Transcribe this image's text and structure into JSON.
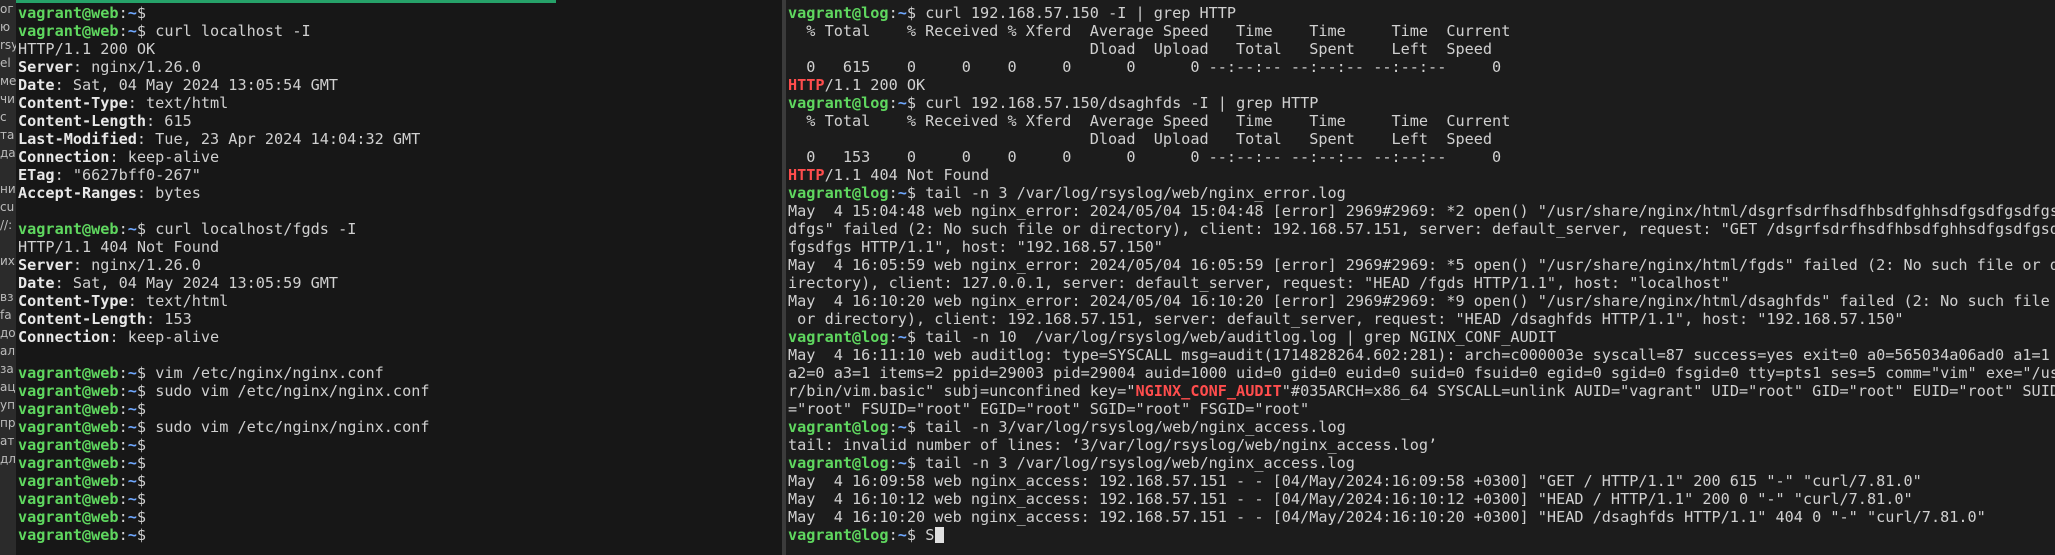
{
  "window": {
    "width": 2055,
    "height": 555
  },
  "colors": {
    "prompt_user": "#5fd75f",
    "prompt_path": "#6fa8ff",
    "highlight": "#ff4d4d",
    "text": "#d0d0d0"
  },
  "side_strip": [
    "ог",
    "ю",
    "rsy",
    "el",
    "ме",
    "чи",
    "с",
    "та",
    "да",
    "",
    "ни",
    "cu",
    "//:",
    "",
    "их",
    "",
    "вз",
    "fa",
    "до",
    "ал",
    "за",
    "ац",
    "уп",
    "пр",
    "ат",
    "дл"
  ],
  "left_terminal": {
    "lines": [
      {
        "segments": [
          {
            "t": "vagrant@web",
            "c": "pr-user"
          },
          {
            "t": ":",
            "c": ""
          },
          {
            "t": "~",
            "c": "pr-path"
          },
          {
            "t": "$",
            "c": ""
          }
        ]
      },
      {
        "segments": [
          {
            "t": "vagrant@web",
            "c": "pr-user"
          },
          {
            "t": ":",
            "c": ""
          },
          {
            "t": "~",
            "c": "pr-path"
          },
          {
            "t": "$ curl localhost -I",
            "c": ""
          }
        ]
      },
      {
        "segments": [
          {
            "t": "HTTP/1.1 200 OK",
            "c": ""
          }
        ]
      },
      {
        "segments": [
          {
            "t": "Server",
            "c": "bold"
          },
          {
            "t": ": nginx/1.26.0",
            "c": ""
          }
        ]
      },
      {
        "segments": [
          {
            "t": "Date",
            "c": "bold"
          },
          {
            "t": ": Sat, 04 May 2024 13:05:54 GMT",
            "c": ""
          }
        ]
      },
      {
        "segments": [
          {
            "t": "Content-Type",
            "c": "bold"
          },
          {
            "t": ": text/html",
            "c": ""
          }
        ]
      },
      {
        "segments": [
          {
            "t": "Content-Length",
            "c": "bold"
          },
          {
            "t": ": 615",
            "c": ""
          }
        ]
      },
      {
        "segments": [
          {
            "t": "Last-Modified",
            "c": "bold"
          },
          {
            "t": ": Tue, 23 Apr 2024 14:04:32 GMT",
            "c": ""
          }
        ]
      },
      {
        "segments": [
          {
            "t": "Connection",
            "c": "bold"
          },
          {
            "t": ": keep-alive",
            "c": ""
          }
        ]
      },
      {
        "segments": [
          {
            "t": "ETag",
            "c": "bold"
          },
          {
            "t": ": \"6627bff0-267\"",
            "c": ""
          }
        ]
      },
      {
        "segments": [
          {
            "t": "Accept-Ranges",
            "c": "bold"
          },
          {
            "t": ": bytes",
            "c": ""
          }
        ]
      },
      {
        "segments": []
      },
      {
        "segments": [
          {
            "t": "vagrant@web",
            "c": "pr-user"
          },
          {
            "t": ":",
            "c": ""
          },
          {
            "t": "~",
            "c": "pr-path"
          },
          {
            "t": "$ curl localhost/fgds -I",
            "c": ""
          }
        ]
      },
      {
        "segments": [
          {
            "t": "HTTP/1.1 404 Not Found",
            "c": ""
          }
        ]
      },
      {
        "segments": [
          {
            "t": "Server",
            "c": "bold"
          },
          {
            "t": ": nginx/1.26.0",
            "c": ""
          }
        ]
      },
      {
        "segments": [
          {
            "t": "Date",
            "c": "bold"
          },
          {
            "t": ": Sat, 04 May 2024 13:05:59 GMT",
            "c": ""
          }
        ]
      },
      {
        "segments": [
          {
            "t": "Content-Type",
            "c": "bold"
          },
          {
            "t": ": text/html",
            "c": ""
          }
        ]
      },
      {
        "segments": [
          {
            "t": "Content-Length",
            "c": "bold"
          },
          {
            "t": ": 153",
            "c": ""
          }
        ]
      },
      {
        "segments": [
          {
            "t": "Connection",
            "c": "bold"
          },
          {
            "t": ": keep-alive",
            "c": ""
          }
        ]
      },
      {
        "segments": []
      },
      {
        "segments": [
          {
            "t": "vagrant@web",
            "c": "pr-user"
          },
          {
            "t": ":",
            "c": ""
          },
          {
            "t": "~",
            "c": "pr-path"
          },
          {
            "t": "$ vim /etc/nginx/nginx.conf",
            "c": ""
          }
        ]
      },
      {
        "segments": [
          {
            "t": "vagrant@web",
            "c": "pr-user"
          },
          {
            "t": ":",
            "c": ""
          },
          {
            "t": "~",
            "c": "pr-path"
          },
          {
            "t": "$ sudo vim /etc/nginx/nginx.conf",
            "c": ""
          }
        ]
      },
      {
        "segments": [
          {
            "t": "vagrant@web",
            "c": "pr-user"
          },
          {
            "t": ":",
            "c": ""
          },
          {
            "t": "~",
            "c": "pr-path"
          },
          {
            "t": "$",
            "c": ""
          }
        ]
      },
      {
        "segments": [
          {
            "t": "vagrant@web",
            "c": "pr-user"
          },
          {
            "t": ":",
            "c": ""
          },
          {
            "t": "~",
            "c": "pr-path"
          },
          {
            "t": "$ sudo vim /etc/nginx/nginx.conf",
            "c": ""
          }
        ]
      },
      {
        "segments": [
          {
            "t": "vagrant@web",
            "c": "pr-user"
          },
          {
            "t": ":",
            "c": ""
          },
          {
            "t": "~",
            "c": "pr-path"
          },
          {
            "t": "$",
            "c": ""
          }
        ]
      },
      {
        "segments": [
          {
            "t": "vagrant@web",
            "c": "pr-user"
          },
          {
            "t": ":",
            "c": ""
          },
          {
            "t": "~",
            "c": "pr-path"
          },
          {
            "t": "$",
            "c": ""
          }
        ]
      },
      {
        "segments": [
          {
            "t": "vagrant@web",
            "c": "pr-user"
          },
          {
            "t": ":",
            "c": ""
          },
          {
            "t": "~",
            "c": "pr-path"
          },
          {
            "t": "$",
            "c": ""
          }
        ]
      },
      {
        "segments": [
          {
            "t": "vagrant@web",
            "c": "pr-user"
          },
          {
            "t": ":",
            "c": ""
          },
          {
            "t": "~",
            "c": "pr-path"
          },
          {
            "t": "$",
            "c": ""
          }
        ]
      },
      {
        "segments": [
          {
            "t": "vagrant@web",
            "c": "pr-user"
          },
          {
            "t": ":",
            "c": ""
          },
          {
            "t": "~",
            "c": "pr-path"
          },
          {
            "t": "$",
            "c": ""
          }
        ]
      },
      {
        "segments": [
          {
            "t": "vagrant@web",
            "c": "pr-user"
          },
          {
            "t": ":",
            "c": ""
          },
          {
            "t": "~",
            "c": "pr-path"
          },
          {
            "t": "$",
            "c": ""
          }
        ]
      }
    ]
  },
  "right_terminal": {
    "lines": [
      {
        "segments": [
          {
            "t": "vagrant@log",
            "c": "pr-user"
          },
          {
            "t": ":",
            "c": ""
          },
          {
            "t": "~",
            "c": "pr-path"
          },
          {
            "t": "$ curl 192.168.57.150 -I | grep HTTP",
            "c": ""
          }
        ]
      },
      {
        "segments": [
          {
            "t": "  % Total    % Received % Xferd  Average Speed   Time    Time     Time  Current",
            "c": ""
          }
        ]
      },
      {
        "segments": [
          {
            "t": "                                 Dload  Upload   Total   Spent    Left  Speed",
            "c": ""
          }
        ]
      },
      {
        "segments": [
          {
            "t": "  0   615    0     0    0     0      0      0 --:--:-- --:--:-- --:--:--     0",
            "c": ""
          }
        ]
      },
      {
        "segments": [
          {
            "t": "HTTP",
            "c": "hl"
          },
          {
            "t": "/1.1 200 OK",
            "c": ""
          }
        ]
      },
      {
        "segments": [
          {
            "t": "vagrant@log",
            "c": "pr-user"
          },
          {
            "t": ":",
            "c": ""
          },
          {
            "t": "~",
            "c": "pr-path"
          },
          {
            "t": "$ curl 192.168.57.150/dsaghfds -I | grep HTTP",
            "c": ""
          }
        ]
      },
      {
        "segments": [
          {
            "t": "  % Total    % Received % Xferd  Average Speed   Time    Time     Time  Current",
            "c": ""
          }
        ]
      },
      {
        "segments": [
          {
            "t": "                                 Dload  Upload   Total   Spent    Left  Speed",
            "c": ""
          }
        ]
      },
      {
        "segments": [
          {
            "t": "  0   153    0     0    0     0      0      0 --:--:-- --:--:-- --:--:--     0",
            "c": ""
          }
        ]
      },
      {
        "segments": [
          {
            "t": "HTTP",
            "c": "hl"
          },
          {
            "t": "/1.1 404 Not Found",
            "c": ""
          }
        ]
      },
      {
        "segments": [
          {
            "t": "vagrant@log",
            "c": "pr-user"
          },
          {
            "t": ":",
            "c": ""
          },
          {
            "t": "~",
            "c": "pr-path"
          },
          {
            "t": "$ tail -n 3 /var/log/rsyslog/web/nginx_error.log",
            "c": ""
          }
        ]
      },
      {
        "segments": [
          {
            "t": "May  4 15:04:48 web nginx_error: 2024/05/04 15:04:48 [error] 2969#2969: *2 open() \"/usr/share/nginx/html/dsgrfsdrfhsdfhbsdfghhsdfgsdfgsdfgs",
            "c": ""
          }
        ]
      },
      {
        "segments": [
          {
            "t": "dfgs\" failed (2: No such file or directory), client: 192.168.57.151, server: default_server, request: \"GET /dsgrfsdrfhsdfhbsdfghhsdfgsdfgsdf",
            "c": ""
          }
        ]
      },
      {
        "segments": [
          {
            "t": "fgsdfgs HTTP/1.1\", host: \"192.168.57.150\"",
            "c": ""
          }
        ]
      },
      {
        "segments": [
          {
            "t": "May  4 16:05:59 web nginx_error: 2024/05/04 16:05:59 [error] 2969#2969: *5 open() \"/usr/share/nginx/html/fgds\" failed (2: No such file or d",
            "c": ""
          }
        ]
      },
      {
        "segments": [
          {
            "t": "irectory), client: 127.0.0.1, server: default_server, request: \"HEAD /fgds HTTP/1.1\", host: \"localhost\"",
            "c": ""
          }
        ]
      },
      {
        "segments": [
          {
            "t": "May  4 16:10:20 web nginx_error: 2024/05/04 16:10:20 [error] 2969#2969: *9 open() \"/usr/share/nginx/html/dsaghfds\" failed (2: No such file",
            "c": ""
          }
        ]
      },
      {
        "segments": [
          {
            "t": " or directory), client: 192.168.57.151, server: default_server, request: \"HEAD /dsaghfds HTTP/1.1\", host: \"192.168.57.150\"",
            "c": ""
          }
        ]
      },
      {
        "segments": [
          {
            "t": "vagrant@log",
            "c": "pr-user"
          },
          {
            "t": ":",
            "c": ""
          },
          {
            "t": "~",
            "c": "pr-path"
          },
          {
            "t": "$ tail -n 10  /var/log/rsyslog/web/auditlog.log | grep NGINX_CONF_AUDIT",
            "c": ""
          }
        ]
      },
      {
        "segments": [
          {
            "t": "May  4 16:11:10 web auditlog: type=SYSCALL msg=audit(1714828264.602:281): arch=c000003e syscall=87 success=yes exit=0 a0=565034a06ad0 a1=1",
            "c": ""
          }
        ]
      },
      {
        "segments": [
          {
            "t": "a2=0 a3=1 items=2 ppid=29003 pid=29004 auid=1000 uid=0 gid=0 euid=0 suid=0 fsuid=0 egid=0 sgid=0 fsgid=0 tty=pts1 ses=5 comm=\"vim\" exe=\"/us",
            "c": ""
          }
        ]
      },
      {
        "segments": [
          {
            "t": "r/bin/vim.basic\" subj=unconfined key=\"",
            "c": ""
          },
          {
            "t": "NGINX_CONF_AUDIT",
            "c": "hl"
          },
          {
            "t": "\"#035ARCH=x86_64 SYSCALL=unlink AUID=\"vagrant\" UID=\"root\" GID=\"root\" EUID=\"root\" SUID",
            "c": ""
          }
        ]
      },
      {
        "segments": [
          {
            "t": "=\"root\" FSUID=\"root\" EGID=\"root\" SGID=\"root\" FSGID=\"root\"",
            "c": ""
          }
        ]
      },
      {
        "segments": [
          {
            "t": "vagrant@log",
            "c": "pr-user"
          },
          {
            "t": ":",
            "c": ""
          },
          {
            "t": "~",
            "c": "pr-path"
          },
          {
            "t": "$ tail -n 3/var/log/rsyslog/web/nginx_access.log",
            "c": ""
          }
        ]
      },
      {
        "segments": [
          {
            "t": "tail: invalid number of lines: ‘3/var/log/rsyslog/web/nginx_access.log’",
            "c": ""
          }
        ]
      },
      {
        "segments": [
          {
            "t": "vagrant@log",
            "c": "pr-user"
          },
          {
            "t": ":",
            "c": ""
          },
          {
            "t": "~",
            "c": "pr-path"
          },
          {
            "t": "$ tail -n 3 /var/log/rsyslog/web/nginx_access.log",
            "c": ""
          }
        ]
      },
      {
        "segments": [
          {
            "t": "May  4 16:09:58 web nginx_access: 192.168.57.151 - - [04/May/2024:16:09:58 +0300] \"GET / HTTP/1.1\" 200 615 \"-\" \"curl/7.81.0\"",
            "c": ""
          }
        ]
      },
      {
        "segments": [
          {
            "t": "May  4 16:10:12 web nginx_access: 192.168.57.151 - - [04/May/2024:16:10:12 +0300] \"HEAD / HTTP/1.1\" 200 0 \"-\" \"curl/7.81.0\"",
            "c": ""
          }
        ]
      },
      {
        "segments": [
          {
            "t": "May  4 16:10:20 web nginx_access: 192.168.57.151 - - [04/May/2024:16:10:20 +0300] \"HEAD /dsaghfds HTTP/1.1\" 404 0 \"-\" \"curl/7.81.0\"",
            "c": ""
          }
        ]
      },
      {
        "segments": [
          {
            "t": "vagrant@log",
            "c": "pr-user"
          },
          {
            "t": ":",
            "c": ""
          },
          {
            "t": "~",
            "c": "pr-path"
          },
          {
            "t": "$ S",
            "c": ""
          }
        ],
        "cursor": true
      }
    ]
  }
}
